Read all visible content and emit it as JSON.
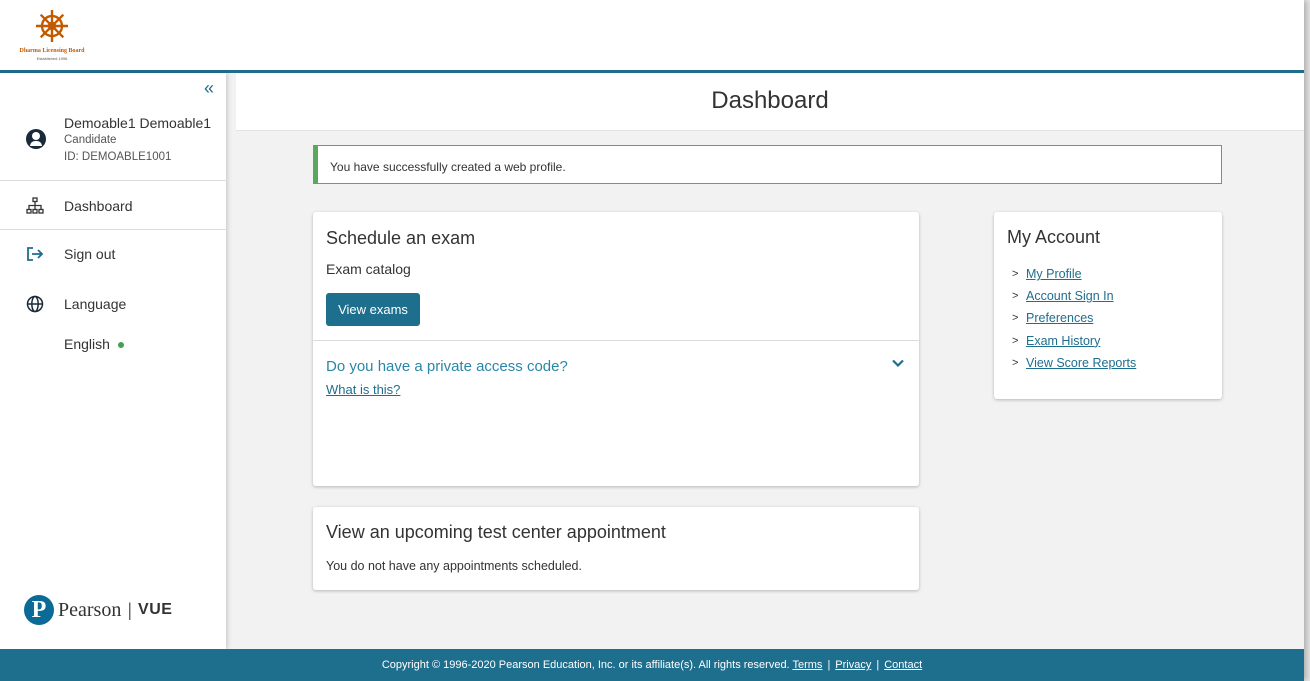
{
  "brand": {
    "org_name": "Dharma Licensing Board",
    "org_tagline": "Established 1996"
  },
  "sidebar": {
    "collapse_icon": "double-chevron-left-icon",
    "user": {
      "name": "Demoable1 Demoable1",
      "role": "Candidate",
      "id": "ID: DEMOABLE1001"
    },
    "nav": [
      {
        "label": "Dashboard",
        "icon": "sitemap-icon"
      },
      {
        "label": "Sign out",
        "icon": "sign-out-icon"
      },
      {
        "label": "Language",
        "icon": "globe-icon"
      }
    ],
    "language_value": "English",
    "vendor": {
      "name": "Pearson",
      "product": "VUE"
    }
  },
  "header": {
    "title": "Dashboard"
  },
  "alert": {
    "message": "You have successfully created a web profile."
  },
  "schedule": {
    "title": "Schedule an exam",
    "catalog_label": "Exam catalog",
    "view_exams_label": "View exams",
    "access_question": "Do you have a private access code?",
    "what_link": "What is this?"
  },
  "appointments": {
    "title": "View an upcoming test center appointment",
    "empty_text": "You do not have any appointments scheduled."
  },
  "account": {
    "title": "My Account",
    "links": [
      "My Profile",
      "Account Sign In",
      "Preferences",
      "Exam History",
      "View Score Reports"
    ]
  },
  "footer": {
    "copyright": "Copyright © 1996-2020 Pearson Education, Inc. or its affiliate(s). All rights reserved.",
    "links": [
      "Terms",
      "Privacy",
      "Contact"
    ]
  },
  "colors": {
    "accent": "#1e6e8e",
    "success": "#5aa85a",
    "status_dot": "#3ea34f"
  }
}
